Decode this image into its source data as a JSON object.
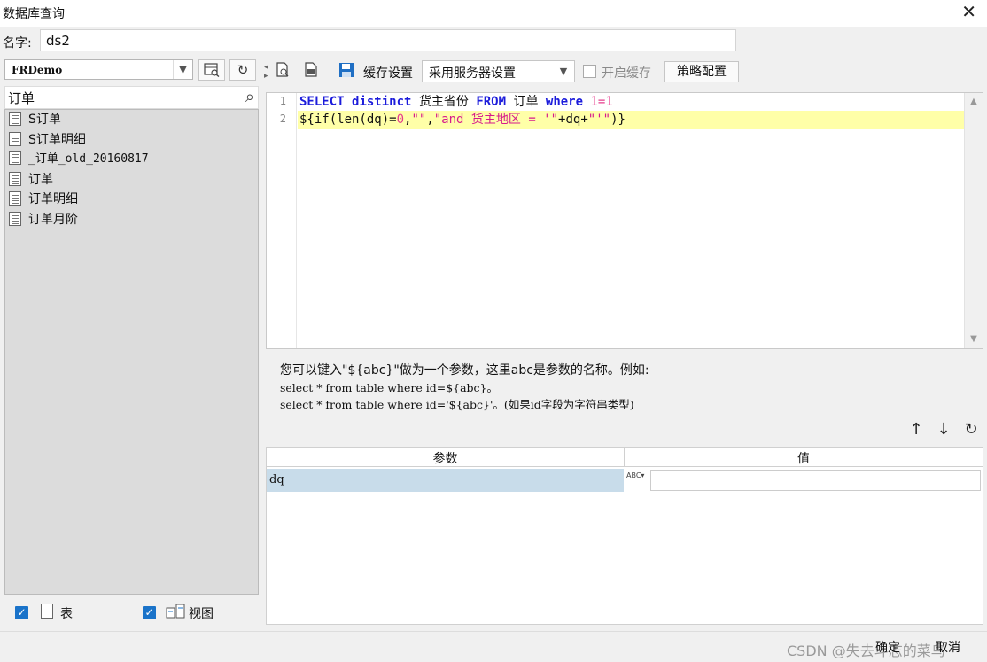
{
  "window": {
    "title": "数据库查询",
    "close_glyph": "✕"
  },
  "name_field": {
    "label": "名字:",
    "value": "ds2"
  },
  "left_panel": {
    "database": "FRDemo",
    "search_value": "订单",
    "tables": [
      "S订单",
      "S订单明细",
      "_订单_old_20160817",
      "订单",
      "订单明细",
      "订单月阶"
    ],
    "filter_table_label": "表",
    "filter_view_label": "视图"
  },
  "toolbar": {
    "cache_label": "缓存设置",
    "cache_mode": "采用服务器设置",
    "enable_cache_label": "开启缓存",
    "policy_button": "策略配置"
  },
  "editor": {
    "line_numbers": [
      "1",
      "2"
    ],
    "line1": {
      "kw_select": "SELECT",
      "kw_distinct": "distinct",
      "t1": " 货主省份 ",
      "kw_from": "FROM",
      "t2": " 订单 ",
      "kw_where": "where",
      "t3": " ",
      "cond": "1=1"
    },
    "line2": {
      "t1": "${if(len(dq)=",
      "n0": "0",
      "t2": ",",
      "s1": "\"\"",
      "t3": ",",
      "s2": "\"and 货主地区 = '\"",
      "t4": "+dq+",
      "s3": "\"'\"",
      "t5": ")}"
    }
  },
  "help": {
    "line1": "您可以键入\"${abc}\"做为一个参数，这里abc是参数的名称。例如:",
    "line2": "select * from table where id=${abc}。",
    "line3": "select * from table where id='${abc}'。(如果id字段为字符串类型)"
  },
  "param_table": {
    "headers": [
      "参数",
      "值"
    ],
    "rows": [
      {
        "name": "dq",
        "type_badge": "ABC",
        "value": ""
      }
    ]
  },
  "footer": {
    "ok": "确定",
    "cancel": "取消",
    "watermark": "CSDN @失去斗志的菜鸟"
  },
  "colors": {
    "keyword": "#1c1cdb",
    "string": "#d61a8c",
    "highlight_line": "#ffffa8",
    "selected_row": "#c8dcea",
    "checkbox": "#1a73c9"
  }
}
